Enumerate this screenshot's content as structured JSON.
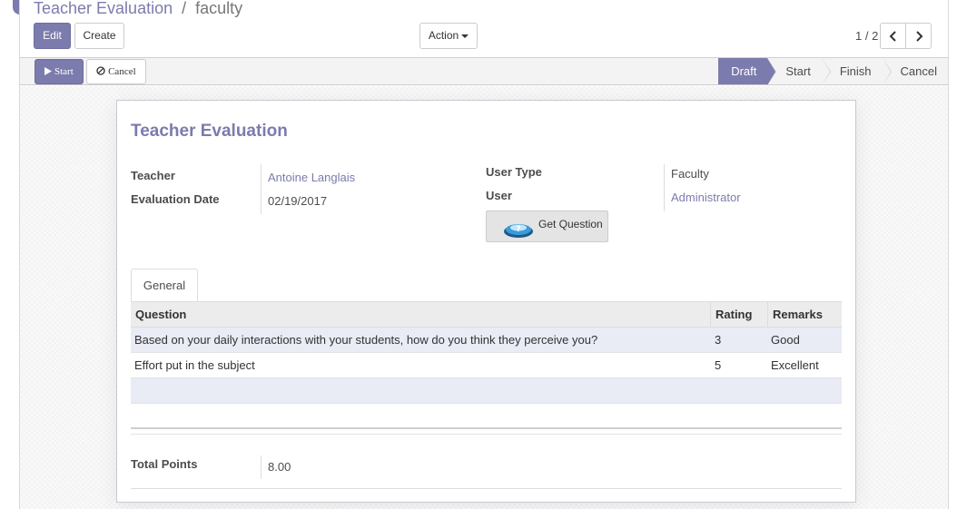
{
  "breadcrumb": {
    "parent": "Teacher Evaluation",
    "separator": "/",
    "current": "faculty"
  },
  "buttons": {
    "edit": "Edit",
    "create": "Create",
    "action": "Action"
  },
  "pager": {
    "value": "1 / 2"
  },
  "statusbar": {
    "start_button": "Start",
    "cancel_button": "Cancel",
    "stages": [
      "Draft",
      "Start",
      "Finish",
      "Cancel"
    ],
    "active_stage": "Draft"
  },
  "form": {
    "title": "Teacher Evaluation",
    "teacher_label": "Teacher",
    "teacher_value": "Antoine Langlais",
    "date_label": "Evaluation Date",
    "date_value": "02/19/2017",
    "user_type_label": "User Type",
    "user_type_value": "Faculty",
    "user_label": "User",
    "user_value": "Administrator",
    "get_question_button": "Get Question",
    "total_label": "Total Points",
    "total_value": "8.00"
  },
  "tabs": [
    "General"
  ],
  "table": {
    "headers": [
      "Question",
      "Rating",
      "Remarks"
    ],
    "rows": [
      [
        "Based on your daily interactions with your students, how do you think they perceive you?",
        "3",
        "Good"
      ],
      [
        "Effort put in the subject",
        "5",
        "Excellent"
      ]
    ]
  },
  "colors": {
    "accent": "#7c7bad",
    "row_highlight": "#e9ebf5"
  },
  "icons": [
    "play-icon",
    "ban-icon",
    "caret-down-icon",
    "chevron-left-icon",
    "chevron-right-icon",
    "question-icon"
  ]
}
